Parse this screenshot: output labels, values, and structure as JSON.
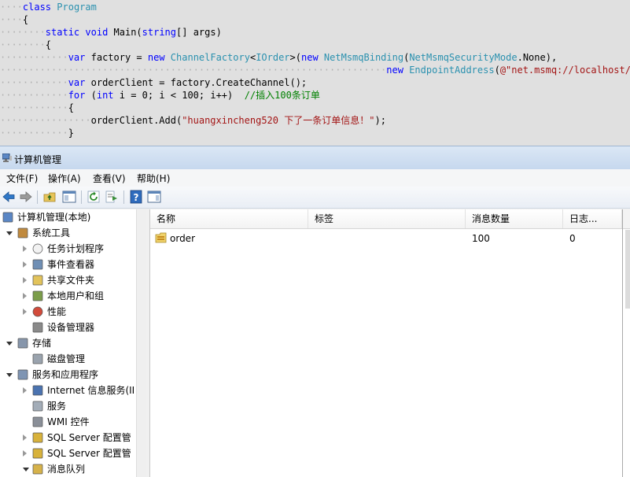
{
  "code_lines": [
    {
      "indent": "····",
      "tokens": [
        {
          "c": "kw",
          "t": "class"
        },
        {
          "c": "p",
          "t": " "
        },
        {
          "c": "ty",
          "t": "Program"
        }
      ]
    },
    {
      "indent": "····",
      "tokens": [
        {
          "c": "p",
          "t": "{"
        }
      ]
    },
    {
      "indent": "········",
      "tokens": [
        {
          "c": "kw",
          "t": "static"
        },
        {
          "c": "p",
          "t": " "
        },
        {
          "c": "kw",
          "t": "void"
        },
        {
          "c": "p",
          "t": " Main("
        },
        {
          "c": "kw",
          "t": "string"
        },
        {
          "c": "p",
          "t": "[] args)"
        }
      ]
    },
    {
      "indent": "········",
      "tokens": [
        {
          "c": "p",
          "t": "{"
        }
      ]
    },
    {
      "indent": "············",
      "tokens": [
        {
          "c": "kw",
          "t": "var"
        },
        {
          "c": "p",
          "t": " factory = "
        },
        {
          "c": "kw",
          "t": "new"
        },
        {
          "c": "p",
          "t": " "
        },
        {
          "c": "ty",
          "t": "ChannelFactory"
        },
        {
          "c": "p",
          "t": "<"
        },
        {
          "c": "ty",
          "t": "IOrder"
        },
        {
          "c": "p",
          "t": ">("
        },
        {
          "c": "kw",
          "t": "new"
        },
        {
          "c": "p",
          "t": " "
        },
        {
          "c": "ty",
          "t": "NetMsmqBinding"
        },
        {
          "c": "p",
          "t": "("
        },
        {
          "c": "ty",
          "t": "NetMsmqSecurityMode"
        },
        {
          "c": "p",
          "t": ".None),"
        }
      ]
    },
    {
      "indent": "····································································",
      "tokens": [
        {
          "c": "kw",
          "t": "new"
        },
        {
          "c": "p",
          "t": " "
        },
        {
          "c": "ty",
          "t": "EndpointAddress"
        },
        {
          "c": "p",
          "t": "("
        },
        {
          "c": "st",
          "t": "@\"net.msmq://localhost/private/order\""
        },
        {
          "c": "p",
          "t": "));"
        }
      ]
    },
    {
      "indent": "············",
      "tokens": [
        {
          "c": "kw",
          "t": "var"
        },
        {
          "c": "p",
          "t": " orderClient = factory.CreateChannel();"
        }
      ]
    },
    {
      "indent": "············",
      "tokens": [
        {
          "c": "kw",
          "t": "for"
        },
        {
          "c": "p",
          "t": " ("
        },
        {
          "c": "kw",
          "t": "int"
        },
        {
          "c": "p",
          "t": " i = 0; i < 100; i++)  "
        },
        {
          "c": "cm",
          "t": "//插入100条订单"
        }
      ]
    },
    {
      "indent": "············",
      "tokens": [
        {
          "c": "p",
          "t": "{"
        }
      ]
    },
    {
      "indent": "················",
      "tokens": [
        {
          "c": "p",
          "t": "orderClient.Add("
        },
        {
          "c": "st",
          "t": "\"huangxincheng520 下了一条订单信息！\""
        },
        {
          "c": "p",
          "t": ");"
        }
      ]
    },
    {
      "indent": "············",
      "tokens": [
        {
          "c": "p",
          "t": "}"
        }
      ]
    }
  ],
  "window": {
    "title": "计算机管理",
    "menu": [
      "文件(F)",
      "操作(A)",
      "查看(V)",
      "帮助(H)"
    ]
  },
  "tree": [
    {
      "label": "计算机管理(本地)",
      "level": 0,
      "arrow": "none",
      "icon": "computer-management-icon"
    },
    {
      "label": "系统工具",
      "level": 1,
      "arrow": "expanded",
      "icon": "system-tools-icon"
    },
    {
      "label": "任务计划程序",
      "level": 2,
      "arrow": "collapsed",
      "icon": "clock-icon"
    },
    {
      "label": "事件查看器",
      "level": 2,
      "arrow": "collapsed",
      "icon": "event-viewer-icon"
    },
    {
      "label": "共享文件夹",
      "level": 2,
      "arrow": "collapsed",
      "icon": "shared-folder-icon"
    },
    {
      "label": "本地用户和组",
      "level": 2,
      "arrow": "collapsed",
      "icon": "users-icon"
    },
    {
      "label": "性能",
      "level": 2,
      "arrow": "collapsed",
      "icon": "performance-icon"
    },
    {
      "label": "设备管理器",
      "level": 2,
      "arrow": "none",
      "icon": "device-manager-icon"
    },
    {
      "label": "存储",
      "level": 1,
      "arrow": "expanded",
      "icon": "storage-icon"
    },
    {
      "label": "磁盘管理",
      "level": 2,
      "arrow": "none",
      "icon": "disk-icon"
    },
    {
      "label": "服务和应用程序",
      "level": 1,
      "arrow": "expanded",
      "icon": "services-apps-icon"
    },
    {
      "label": "Internet 信息服务(II",
      "level": 2,
      "arrow": "collapsed",
      "icon": "iis-icon"
    },
    {
      "label": "服务",
      "level": 2,
      "arrow": "none",
      "icon": "services-gear-icon"
    },
    {
      "label": "WMI 控件",
      "level": 2,
      "arrow": "none",
      "icon": "wmi-icon"
    },
    {
      "label": "SQL Server 配置管",
      "level": 2,
      "arrow": "collapsed",
      "icon": "sql-server-icon"
    },
    {
      "label": "SQL Server 配置管",
      "level": 2,
      "arrow": "collapsed",
      "icon": "sql-server-icon"
    },
    {
      "label": "消息队列",
      "level": 2,
      "arrow": "expanded",
      "icon": "message-queue-icon"
    }
  ],
  "list": {
    "columns": [
      "名称",
      "标签",
      "消息数量",
      "日志..."
    ],
    "rows": [
      {
        "name": "order",
        "label": "",
        "count": "100",
        "journal": "0",
        "icon": "queue-folder-icon"
      }
    ]
  },
  "colors": {
    "keyword": "#0000ff",
    "type": "#2b91af",
    "string": "#a31515",
    "comment": "#008000"
  }
}
